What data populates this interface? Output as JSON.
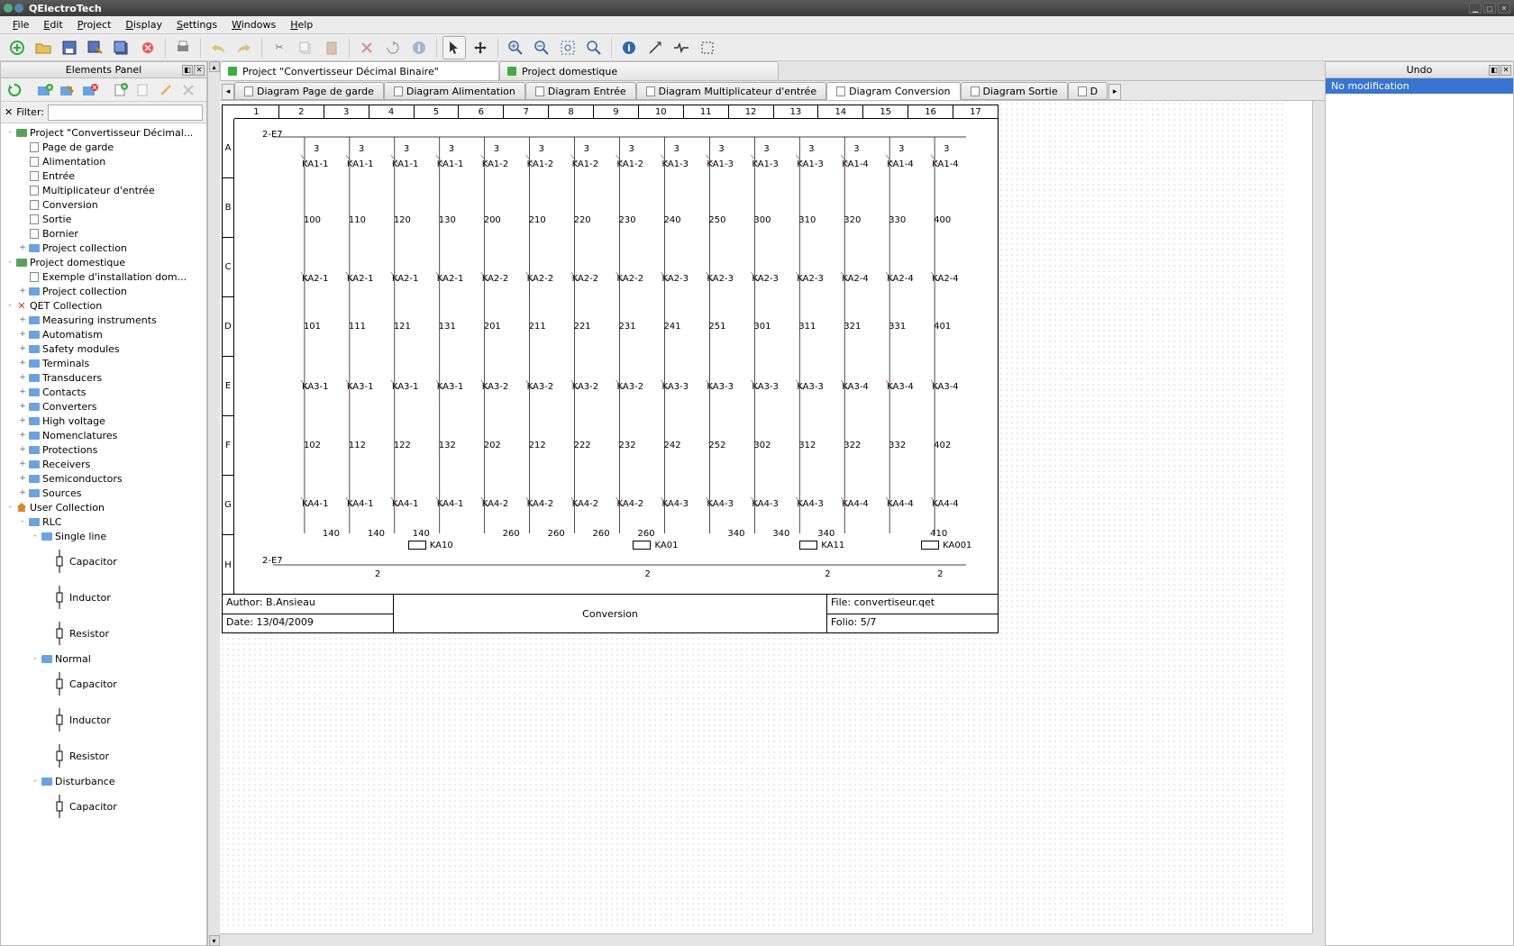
{
  "app_title": "QElectroTech",
  "menu": [
    "File",
    "Edit",
    "Project",
    "Display",
    "Settings",
    "Windows",
    "Help"
  ],
  "panels": {
    "elements": "Elements Panel",
    "undo": "Undo"
  },
  "filter_label": "Filter:",
  "tree": [
    {
      "d": 0,
      "l": "Project \"Convertisseur Décimal...",
      "i": "folder-green",
      "t": "-"
    },
    {
      "d": 1,
      "l": "Page de garde",
      "i": "page"
    },
    {
      "d": 1,
      "l": "Alimentation",
      "i": "page"
    },
    {
      "d": 1,
      "l": "Entrée",
      "i": "page"
    },
    {
      "d": 1,
      "l": "Multiplicateur d'entrée",
      "i": "page"
    },
    {
      "d": 1,
      "l": "Conversion",
      "i": "page"
    },
    {
      "d": 1,
      "l": "Sortie",
      "i": "page"
    },
    {
      "d": 1,
      "l": "Bornier",
      "i": "page"
    },
    {
      "d": 1,
      "l": "Project collection",
      "i": "folder",
      "t": "+"
    },
    {
      "d": 0,
      "l": "Project domestique",
      "i": "folder-green",
      "t": "-"
    },
    {
      "d": 1,
      "l": "Exemple d'installation dom...",
      "i": "page"
    },
    {
      "d": 1,
      "l": "Project collection",
      "i": "folder",
      "t": "+"
    },
    {
      "d": 0,
      "l": "QET Collection",
      "i": "x",
      "t": "-"
    },
    {
      "d": 1,
      "l": "Measuring instruments",
      "i": "folder",
      "t": "+"
    },
    {
      "d": 1,
      "l": "Automatism",
      "i": "folder",
      "t": "+"
    },
    {
      "d": 1,
      "l": "Safety modules",
      "i": "folder",
      "t": "+"
    },
    {
      "d": 1,
      "l": "Terminals",
      "i": "folder",
      "t": "+"
    },
    {
      "d": 1,
      "l": "Transducers",
      "i": "folder",
      "t": "+"
    },
    {
      "d": 1,
      "l": "Contacts",
      "i": "folder",
      "t": "+"
    },
    {
      "d": 1,
      "l": "Converters",
      "i": "folder",
      "t": "+"
    },
    {
      "d": 1,
      "l": "High voltage",
      "i": "folder",
      "t": "+"
    },
    {
      "d": 1,
      "l": "Nomenclatures",
      "i": "folder",
      "t": "+"
    },
    {
      "d": 1,
      "l": "Protections",
      "i": "folder",
      "t": "+"
    },
    {
      "d": 1,
      "l": "Receivers",
      "i": "folder",
      "t": "+"
    },
    {
      "d": 1,
      "l": "Semiconductors",
      "i": "folder",
      "t": "+"
    },
    {
      "d": 1,
      "l": "Sources",
      "i": "folder",
      "t": "+"
    },
    {
      "d": 0,
      "l": "User Collection",
      "i": "home",
      "t": "-"
    },
    {
      "d": 1,
      "l": "RLC",
      "i": "folder",
      "t": "-"
    },
    {
      "d": 2,
      "l": "Single line",
      "i": "folder",
      "t": "-"
    },
    {
      "d": 3,
      "l": "Capacitor",
      "i": "el",
      "big": true
    },
    {
      "d": 3,
      "l": "Inductor",
      "i": "el",
      "big": true
    },
    {
      "d": 3,
      "l": "Resistor",
      "i": "el",
      "big": true
    },
    {
      "d": 2,
      "l": "Normal",
      "i": "folder",
      "t": "-"
    },
    {
      "d": 3,
      "l": "Capacitor",
      "i": "el",
      "big": true
    },
    {
      "d": 3,
      "l": "Inductor",
      "i": "el",
      "big": true
    },
    {
      "d": 3,
      "l": "Resistor",
      "i": "el",
      "big": true
    },
    {
      "d": 2,
      "l": "Disturbance",
      "i": "folder",
      "t": "-"
    },
    {
      "d": 3,
      "l": "Capacitor",
      "i": "el",
      "big": true
    }
  ],
  "project_tabs": [
    {
      "label": "Project \"Convertisseur Décimal Binaire\"",
      "active": true
    },
    {
      "label": "Project domestique",
      "active": false
    }
  ],
  "diagram_tabs": [
    {
      "label": "Diagram Page de garde"
    },
    {
      "label": "Diagram Alimentation"
    },
    {
      "label": "Diagram Entrée"
    },
    {
      "label": "Diagram Multiplicateur d'entrée"
    },
    {
      "label": "Diagram Conversion",
      "active": true
    },
    {
      "label": "Diagram Sortie"
    },
    {
      "label": "D"
    }
  ],
  "columns": [
    "1",
    "2",
    "3",
    "4",
    "5",
    "6",
    "7",
    "8",
    "9",
    "10",
    "11",
    "12",
    "13",
    "14",
    "15",
    "16",
    "17"
  ],
  "rows": [
    "A",
    "B",
    "C",
    "D",
    "E",
    "F",
    "G",
    "H"
  ],
  "title_block": {
    "author": "Author: B.Ansieau",
    "date": "Date: 13/04/2009",
    "title": "Conversion",
    "file": "File: convertiseur.qet",
    "folio": "Folio: 5/7"
  },
  "undo_item": "No modification",
  "chart_data": {
    "type": "schematic",
    "ref_top": "2-E7",
    "ref_bottom": "2-E7",
    "top_labels": [
      "3",
      "3",
      "3",
      "3",
      "3",
      "3",
      "3",
      "3",
      "3",
      "3",
      "3",
      "3",
      "3",
      "3",
      "3"
    ],
    "bottom_labels": [
      "2",
      "2",
      "2",
      "2"
    ],
    "relays": {
      "row1": [
        "KA1-1",
        "KA1-1",
        "KA1-1",
        "KA1-1",
        "KA1-2",
        "KA1-2",
        "KA1-2",
        "KA1-2",
        "KA1-3",
        "KA1-3",
        "KA1-3",
        "KA1-3",
        "KA1-4",
        "KA1-4",
        "KA1-4"
      ],
      "row2": [
        "KA2-1",
        "KA2-1",
        "KA2-1",
        "KA2-1",
        "KA2-2",
        "KA2-2",
        "KA2-2",
        "KA2-2",
        "KA2-3",
        "KA2-3",
        "KA2-3",
        "KA2-3",
        "KA2-4",
        "KA2-4",
        "KA2-4"
      ],
      "row3": [
        "KA3-1",
        "KA3-1",
        "KA3-1",
        "KA3-1",
        "KA3-2",
        "KA3-2",
        "KA3-2",
        "KA3-2",
        "KA3-3",
        "KA3-3",
        "KA3-3",
        "KA3-3",
        "KA3-4",
        "KA3-4",
        "KA3-4"
      ],
      "row4": [
        "KA4-1",
        "KA4-1",
        "KA4-1",
        "KA4-1",
        "KA4-2",
        "KA4-2",
        "KA4-2",
        "KA4-2",
        "KA4-3",
        "KA4-3",
        "KA4-3",
        "KA4-3",
        "KA4-4",
        "KA4-4",
        "KA4-4"
      ]
    },
    "values": {
      "v1": [
        "100",
        "110",
        "120",
        "130",
        "200",
        "210",
        "220",
        "230",
        "240",
        "250",
        "300",
        "310",
        "320",
        "330",
        "400"
      ],
      "v2": [
        "101",
        "111",
        "121",
        "131",
        "201",
        "211",
        "221",
        "231",
        "241",
        "251",
        "301",
        "311",
        "321",
        "331",
        "401"
      ],
      "v3": [
        "102",
        "112",
        "122",
        "132",
        "202",
        "212",
        "222",
        "232",
        "242",
        "252",
        "302",
        "312",
        "322",
        "332",
        "402"
      ],
      "v4": [
        "140",
        "140",
        "140",
        "260",
        "260",
        "260",
        "260",
        "340",
        "340",
        "340",
        "410"
      ]
    },
    "coils": [
      "KA10",
      "KA01",
      "KA11",
      "KA001"
    ]
  }
}
